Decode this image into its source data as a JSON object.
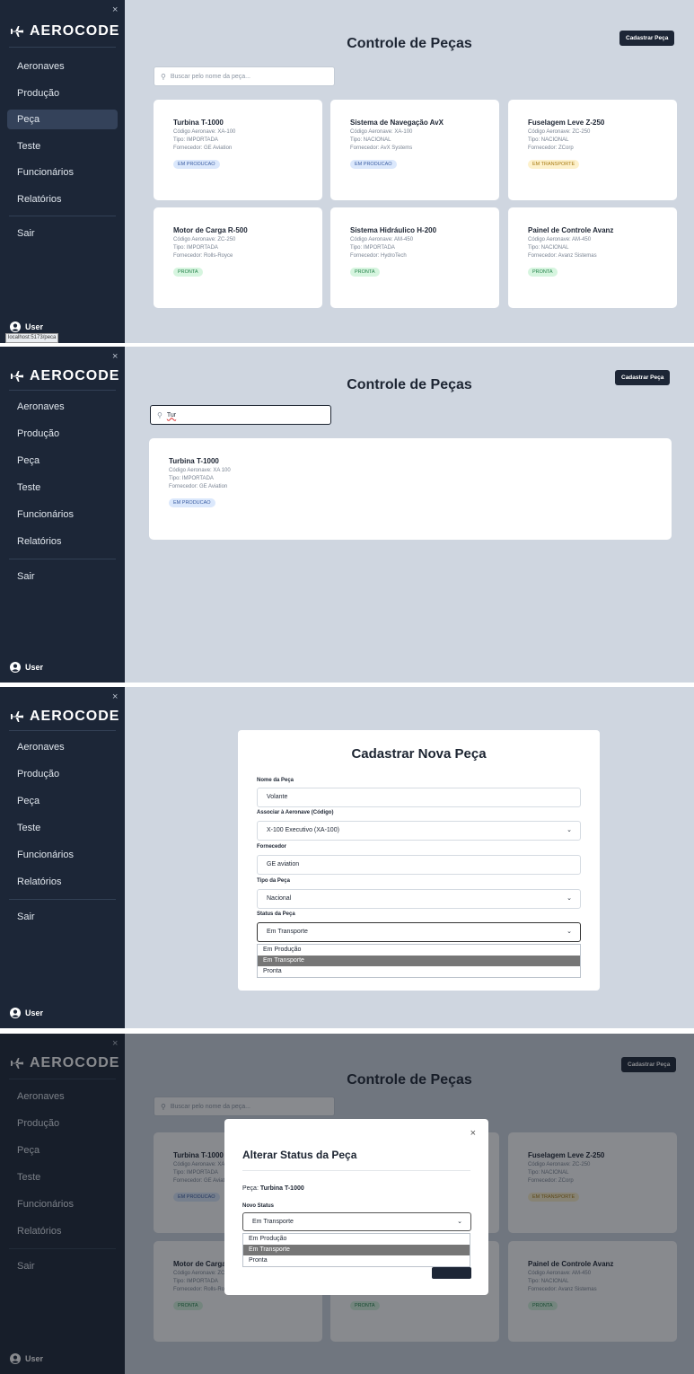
{
  "app": {
    "brand": "AEROCODE",
    "close_glyph": "×",
    "user_label": "User",
    "nav": [
      {
        "label": "Aeronaves"
      },
      {
        "label": "Produção"
      },
      {
        "label": "Peça"
      },
      {
        "label": "Teste"
      },
      {
        "label": "Funcionários"
      },
      {
        "label": "Relatórios"
      },
      {
        "label": "Sair"
      }
    ],
    "url_tooltip": "localhost:5173/peca"
  },
  "list_view": {
    "title": "Controle de Peças",
    "add_button": "Cadastrar Peça",
    "search_placeholder": "Buscar pelo nome da peça...",
    "cards": [
      {
        "name": "Turbina T-1000",
        "codigo": "Código Aeronave: XA-100",
        "tipo": "Tipo: IMPORTADA",
        "fornecedor": "Fornecedor: GE Aviation",
        "status": "EM PRODUCAO",
        "status_kind": "prod"
      },
      {
        "name": "Sistema de Navegação AvX",
        "codigo": "Código Aeronave: XA-100",
        "tipo": "Tipo: NACIONAL",
        "fornecedor": "Fornecedor: AvX Systems",
        "status": "EM PRODUCAO",
        "status_kind": "prod"
      },
      {
        "name": "Fuselagem Leve Z-250",
        "codigo": "Código Aeronave: ZC-250",
        "tipo": "Tipo: NACIONAL",
        "fornecedor": "Fornecedor: ZCorp",
        "status": "EM TRANSPORTE",
        "status_kind": "trans"
      },
      {
        "name": "Motor de Carga R-500",
        "codigo": "Código Aeronave: ZC-250",
        "tipo": "Tipo: IMPORTADA",
        "fornecedor": "Fornecedor: Rolls-Royce",
        "status": "PRONTA",
        "status_kind": "ok"
      },
      {
        "name": "Sistema Hidráulico H-200",
        "codigo": "Código Aeronave: AM-450",
        "tipo": "Tipo: IMPORTADA",
        "fornecedor": "Fornecedor: HydroTech",
        "status": "PRONTA",
        "status_kind": "ok"
      },
      {
        "name": "Painel de Controle Avanz",
        "codigo": "Código Aeronave: AM-450",
        "tipo": "Tipo: NACIONAL",
        "fornecedor": "Fornecedor: Avanz Sistemas",
        "status": "PRONTA",
        "status_kind": "ok"
      }
    ]
  },
  "search_view": {
    "search_value": "Tur",
    "result": {
      "name": "Turbina T-1000",
      "codigo": "Código Aeronave: XA 100",
      "tipo": "Tipo: IMPORTADA",
      "fornecedor": "Fornecedor: GE Aviation",
      "status": "EM PRODUCAO"
    }
  },
  "form_view": {
    "title": "Cadastrar Nova Peça",
    "fields": {
      "nome_label": "Nome da Peça",
      "nome_value": "Volante",
      "aeronave_label": "Associar à Aeronave (Código)",
      "aeronave_value": "X-100 Executivo (XA-100)",
      "fornecedor_label": "Fornecedor",
      "fornecedor_value": "GE aviation",
      "tipo_label": "Tipo da Peça",
      "tipo_value": "Nacional",
      "status_label": "Status da Peça",
      "status_value": "Em Transporte"
    },
    "status_options": [
      "Em Produção",
      "Em Transporte",
      "Pronta"
    ],
    "selected_option": "Em Transporte"
  },
  "modal_view": {
    "title": "Alterar Status da Peça",
    "close_glyph": "×",
    "peca_prefix": "Peça: ",
    "peca_name": "Turbina T-1000",
    "novo_status_label": "Novo Status",
    "select_value": "Em Transporte",
    "options": [
      "Em Produção",
      "Em Transporte",
      "Pronta"
    ],
    "selected_option": "Em Transporte"
  },
  "colors": {
    "sidebar": "#1c2637",
    "background": "#cfd6e0",
    "button": "#1d2636"
  }
}
